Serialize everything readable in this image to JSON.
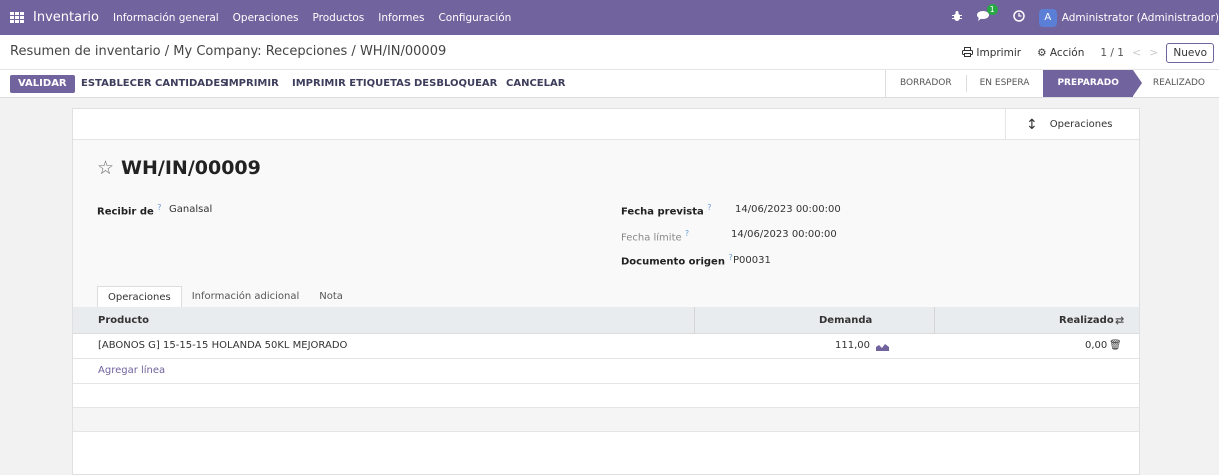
{
  "navbar": {
    "brand": "Inventario",
    "menu": [
      "Información general",
      "Operaciones",
      "Productos",
      "Informes",
      "Configuración"
    ],
    "chat_badge": "1",
    "avatar_letter": "A",
    "user": "Administrator (Administrador)"
  },
  "control": {
    "breadcrumb": "Resumen de inventario / My Company: Recepciones / WH/IN/00009",
    "print": "Imprimir",
    "action": "Acción",
    "pager": "1 / 1",
    "new": "Nuevo"
  },
  "actions": {
    "validate": "VALIDAR",
    "buttons": [
      "ESTABLECER CANTIDADES",
      "IMPRIMIR",
      "IMPRIMIR ETIQUETAS",
      "DESBLOQUEAR",
      "CANCELAR"
    ],
    "statuses": [
      "BORRADOR",
      "EN ESPERA",
      "PREPARADO",
      "REALIZADO"
    ],
    "active_status": "PREPARADO"
  },
  "sheet": {
    "smart_button": "Operaciones",
    "title": "WH/IN/00009",
    "fields": {
      "receive_from_label": "Recibir de",
      "receive_from_value": "Ganalsal",
      "scheduled_label": "Fecha prevista",
      "scheduled_value": "14/06/2023 00:00:00",
      "deadline_label": "Fecha límite",
      "deadline_value": "14/06/2023 00:00:00",
      "origin_label": "Documento origen",
      "origin_value": "P00031",
      "help_mark": "?"
    },
    "tabs": [
      "Operaciones",
      "Información adicional",
      "Nota"
    ],
    "table": {
      "headers": [
        "Producto",
        "Demanda",
        "Realizado"
      ],
      "rows": [
        {
          "product": "[ABONOS G] 15-15-15 HOLANDA 50KL MEJORADO",
          "demand": "111,00",
          "done": "0,00"
        }
      ],
      "add_line": "Agregar línea"
    }
  },
  "colors": {
    "brand": "#71639e",
    "badge": "#28a745",
    "avatar": "#5b7fd6"
  }
}
